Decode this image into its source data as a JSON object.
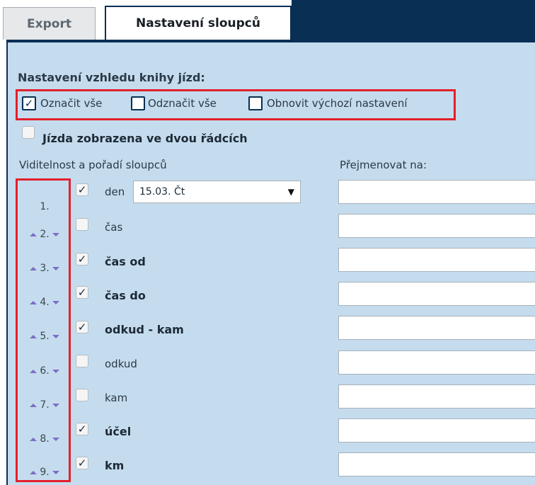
{
  "tabs": [
    {
      "label": "Export",
      "active": false
    },
    {
      "label": "Nastavení sloupců",
      "active": true
    }
  ],
  "section_title": "Nastavení vzhledu knihy jízd:",
  "actions": {
    "select_all": "Označit vše",
    "deselect_all": "Odznačit vše",
    "restore_default": "Obnovit výchozí nastavení"
  },
  "two_rows_label": "Jízda zobrazena ve dvou řádcích",
  "two_rows_checked": false,
  "headers": {
    "visibility": "Viditelnost a pořadí sloupců",
    "rename": "Přejmenovat na:"
  },
  "date_select_value": "15.03. Čt",
  "rows": [
    {
      "order": "1.",
      "label": "den",
      "checked": true,
      "bold": false
    },
    {
      "order": "2.",
      "label": "čas",
      "checked": false,
      "bold": false
    },
    {
      "order": "3.",
      "label": "čas od",
      "checked": true,
      "bold": true
    },
    {
      "order": "4.",
      "label": "čas do",
      "checked": true,
      "bold": true
    },
    {
      "order": "5.",
      "label": "odkud - kam",
      "checked": true,
      "bold": true
    },
    {
      "order": "6.",
      "label": "odkud",
      "checked": false,
      "bold": false
    },
    {
      "order": "7.",
      "label": "kam",
      "checked": false,
      "bold": false
    },
    {
      "order": "8.",
      "label": "účel",
      "checked": true,
      "bold": true
    },
    {
      "order": "9.",
      "label": "km",
      "checked": true,
      "bold": true
    }
  ],
  "colors": {
    "navy": "#0a2f55",
    "panel": "#c5dcee",
    "highlight": "#e3202a",
    "arrows": "#7a6ec8"
  }
}
